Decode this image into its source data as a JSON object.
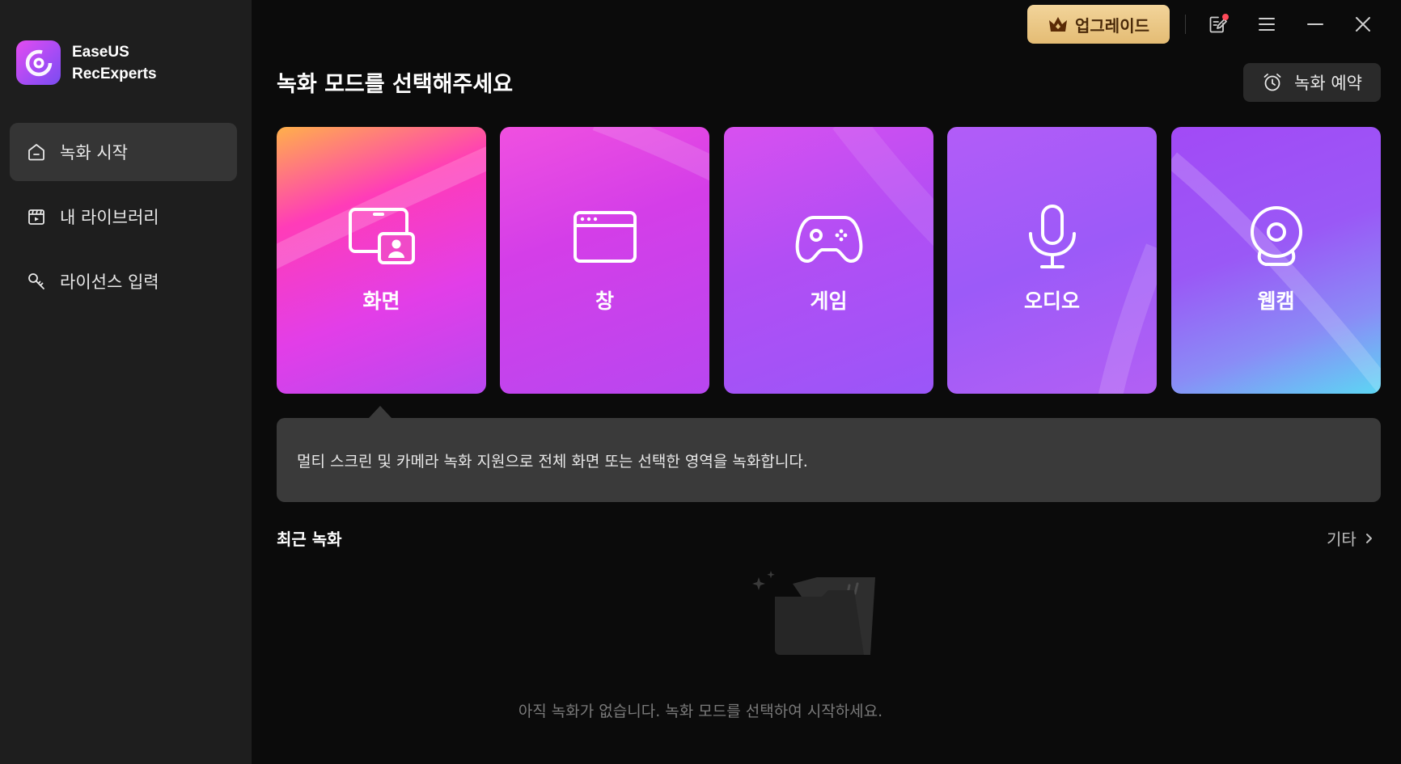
{
  "app": {
    "name_line1": "EaseUS",
    "name_line2": "RecExperts",
    "logo_icon": "recexperts-logo-icon"
  },
  "sidebar": {
    "items": [
      {
        "label": "녹화 시작",
        "icon": "home-icon",
        "active": true
      },
      {
        "label": "내 라이브러리",
        "icon": "library-icon",
        "active": false
      },
      {
        "label": "라이선스 입력",
        "icon": "key-icon",
        "active": false
      }
    ]
  },
  "topbar": {
    "upgrade_label": "업그레이드",
    "upgrade_icon": "crown-icon"
  },
  "main": {
    "title": "녹화 모드를 선택해주세요",
    "schedule_label": "녹화 예약",
    "modes": [
      {
        "label": "화면",
        "icon": "screen-icon"
      },
      {
        "label": "창",
        "icon": "window-icon"
      },
      {
        "label": "게임",
        "icon": "gamepad-icon"
      },
      {
        "label": "오디오",
        "icon": "microphone-icon"
      },
      {
        "label": "웹캠",
        "icon": "webcam-icon"
      }
    ],
    "description": "멀티 스크린 및 카메라 녹화 지원으로 전체 화면 또는 선택한 영역을 녹화합니다."
  },
  "recent": {
    "title": "최근 녹화",
    "more_label": "기타",
    "empty_message": "아직 녹화가 없습니다. 녹화 모드를 선택하여 시작하세요."
  },
  "colors": {
    "sidebar_bg": "#1e1e1e",
    "main_bg": "#0b0b0b",
    "upgrade_gold": "#e8c47e",
    "notification": "#ff4a5a"
  }
}
